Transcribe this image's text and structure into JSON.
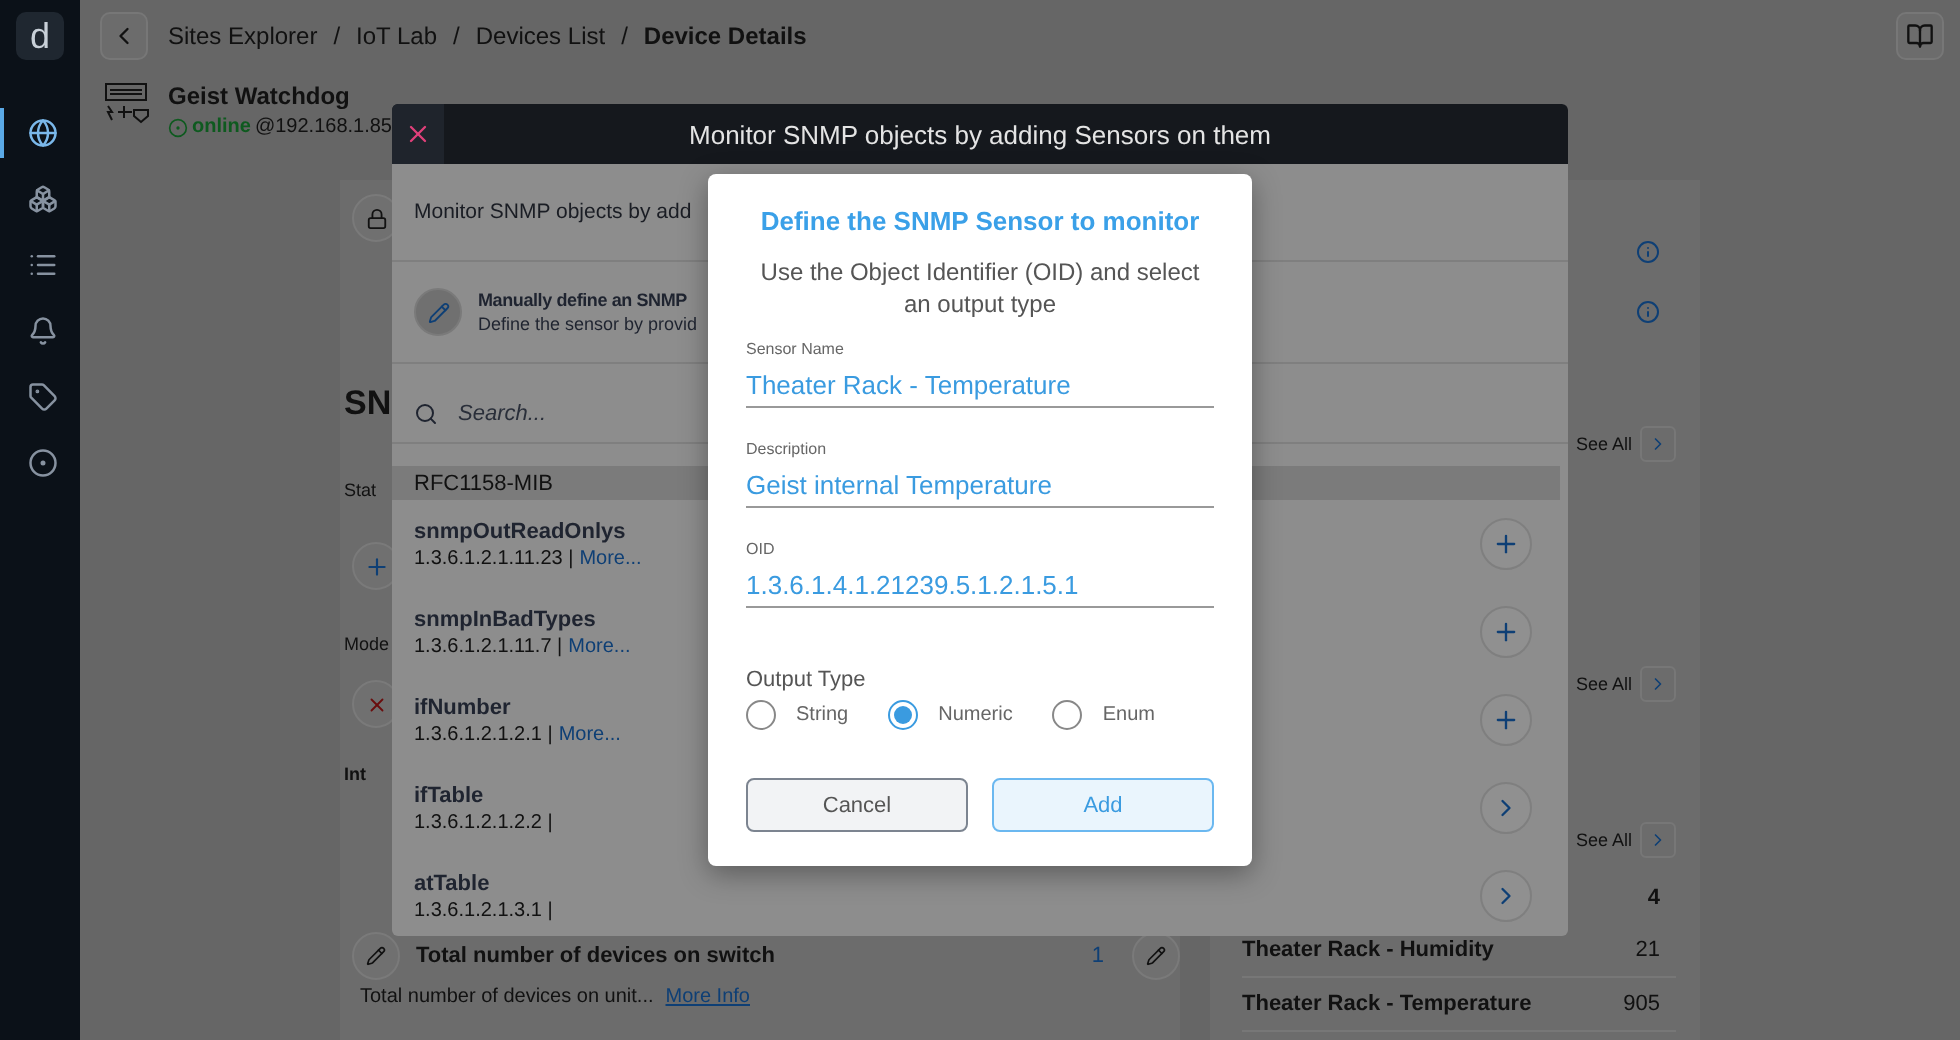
{
  "sidebar": {
    "logo": "d",
    "items": [
      {
        "selected": true
      },
      {
        "selected": false
      },
      {
        "selected": false
      },
      {
        "selected": false
      },
      {
        "selected": false
      },
      {
        "selected": false
      }
    ]
  },
  "breadcrumbs": [
    {
      "label": "Sites Explorer",
      "current": false
    },
    {
      "separator": "/",
      "label": "IoT Lab",
      "current": false
    },
    {
      "separator": "/",
      "label": "Devices List",
      "current": false
    },
    {
      "separator": "/",
      "label": "Device Details",
      "current": true
    }
  ],
  "device": {
    "name": "Geist Watchdog",
    "status": "online",
    "address": "@192.168.1.85"
  },
  "background": {
    "left": {
      "heading": "SN",
      "status_label": "Stat",
      "mode_label": "Mode",
      "interval_label": "Int",
      "sensor": {
        "title": "Total number of devices on switch",
        "count": "1",
        "description": "Total number of devices on unit...",
        "link": "More Info"
      }
    },
    "right": {
      "see_all": [
        "See All",
        "See All",
        "See All"
      ],
      "summary_value": "4",
      "rows": [
        {
          "name": "Theater Rack - Humidity",
          "value": "21"
        },
        {
          "name": "Theater Rack - Temperature",
          "value": "905"
        }
      ]
    }
  },
  "modal": {
    "title": "Monitor SNMP objects by adding Sensors on them",
    "intro": "Monitor SNMP objects by add",
    "manual": {
      "title": "Manually define an SNMP",
      "subtitle": "Define the sensor by provid"
    },
    "search": {
      "placeholder": "Search..."
    },
    "group": "RFC1158-MIB",
    "objects": [
      {
        "name": "snmpOutReadOnlys",
        "oid": "1.3.6.1.2.1.11.23 |",
        "link": "More...",
        "kind": "add"
      },
      {
        "name": "snmpInBadTypes",
        "oid": "1.3.6.1.2.1.11.7 |",
        "link": "More...",
        "kind": "add"
      },
      {
        "name": "ifNumber",
        "oid": "1.3.6.1.2.1.2.1 |",
        "link": "More...",
        "kind": "add"
      },
      {
        "name": "ifTable",
        "oid": "1.3.6.1.2.1.2.2 |",
        "kind": "open"
      },
      {
        "name": "atTable",
        "oid": "1.3.6.1.2.1.3.1 |",
        "kind": "open"
      }
    ]
  },
  "dialog": {
    "title": "Define the SNMP Sensor to monitor",
    "subtitle": "Use the Object Identifier (OID) and select an output type",
    "fields": [
      {
        "label": "Sensor Name",
        "value": "Theater Rack - Temperature"
      },
      {
        "label": "Description",
        "value": "Geist internal Temperature"
      },
      {
        "label": "OID",
        "value": "1.3.6.1.4.1.21239.5.1.2.1.5.1"
      }
    ],
    "output_type": {
      "label": "Output Type",
      "options": [
        {
          "label": "String",
          "selected": false
        },
        {
          "label": "Numeric",
          "selected": true
        },
        {
          "label": "Enum",
          "selected": false
        }
      ]
    },
    "buttons": [
      {
        "label": "Cancel",
        "kind": "secondary"
      },
      {
        "label": "Add",
        "kind": "primary"
      }
    ]
  }
}
